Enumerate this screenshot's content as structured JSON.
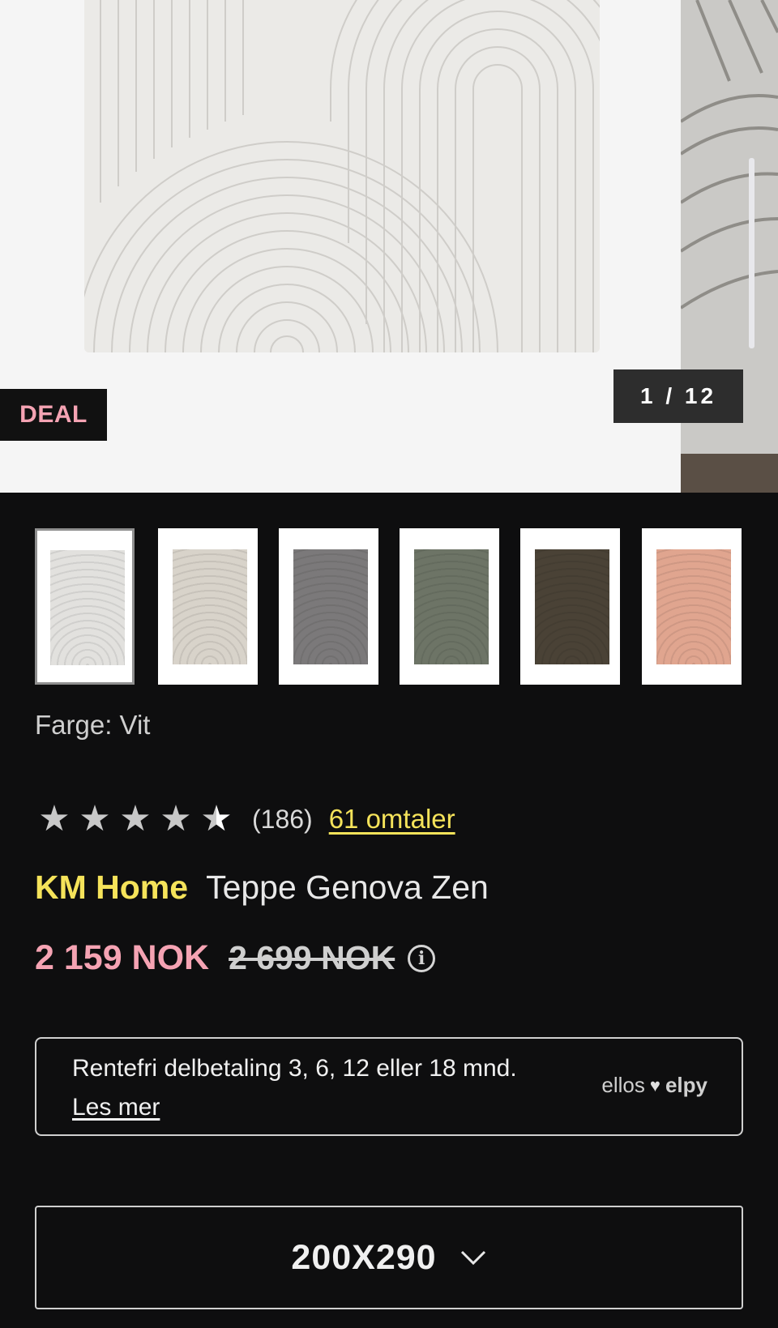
{
  "gallery": {
    "badge": "DEAL",
    "counter": "1 / 12"
  },
  "thumbnails": [
    {
      "name": "thumb-white",
      "color": "#e2e1de",
      "selected": true
    },
    {
      "name": "thumb-beige",
      "color": "#d8d3ca",
      "selected": false
    },
    {
      "name": "thumb-grey",
      "color": "#7b797a",
      "selected": false
    },
    {
      "name": "thumb-green",
      "color": "#6d7466",
      "selected": false
    },
    {
      "name": "thumb-brown",
      "color": "#4a4236",
      "selected": false
    },
    {
      "name": "thumb-rose",
      "color": "#e0a58f",
      "selected": false
    }
  ],
  "color": {
    "label": "Farge: Vit"
  },
  "rating": {
    "value": 4.5,
    "max": 5,
    "count": "(186)",
    "reviews_link": "61 omtaler"
  },
  "product": {
    "brand": "KM Home",
    "name": "Teppe Genova Zen"
  },
  "price": {
    "current": "2 159 NOK",
    "old": "2 699 NOK",
    "info_icon": "info-icon"
  },
  "financing": {
    "text": "Rentefri delbetaling 3, 6, 12 eller 18 mnd.",
    "link": "Les mer",
    "partner_left": "ellos",
    "partner_right": "elpy"
  },
  "size": {
    "selected": "200X290"
  },
  "colors": {
    "background": "#0e0e0f",
    "accent_yellow": "#f5e35a",
    "accent_pink": "#f5a3b3"
  }
}
